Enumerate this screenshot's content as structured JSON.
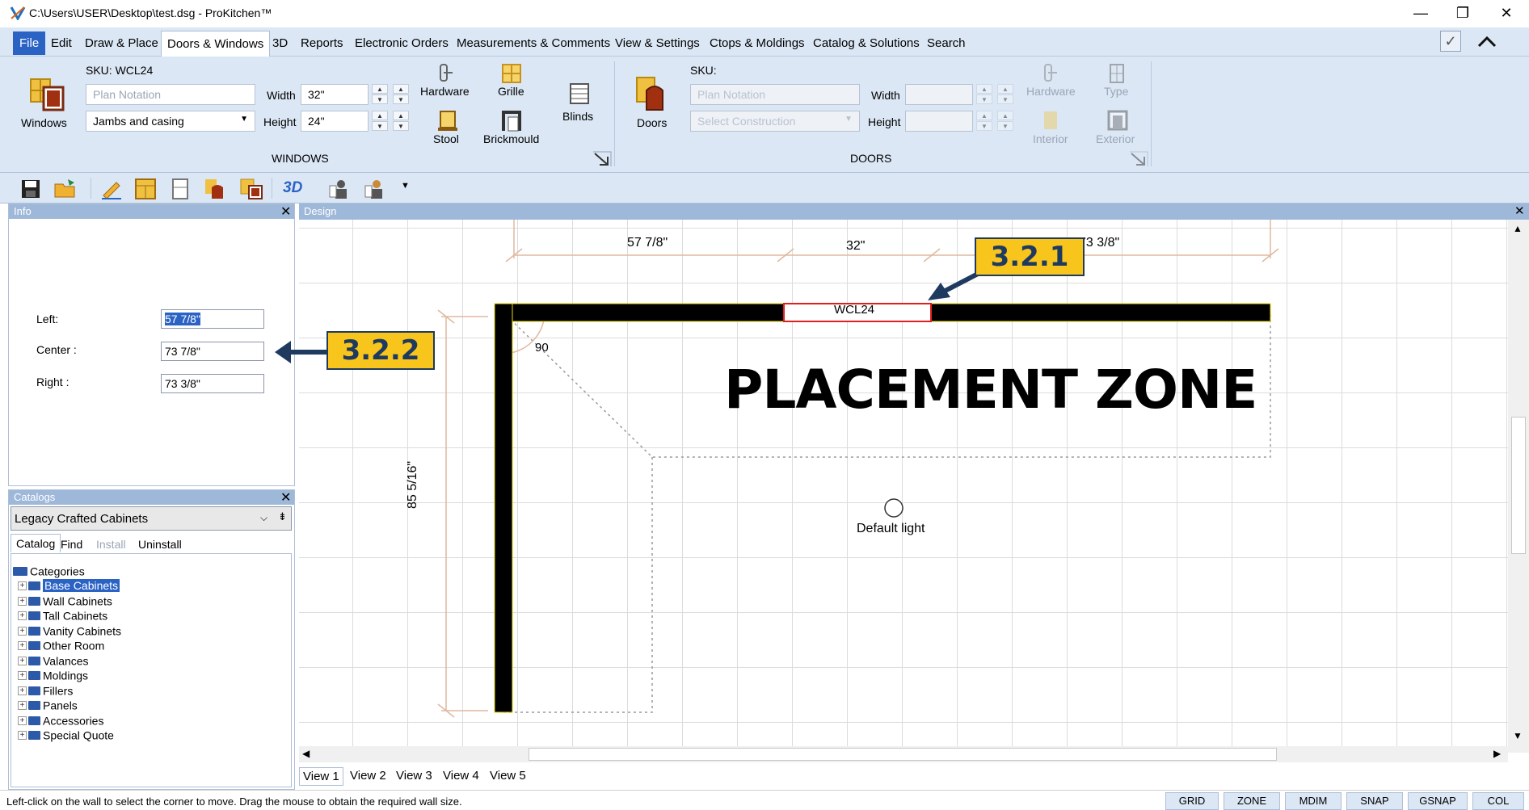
{
  "window": {
    "title": "C:\\Users\\USER\\Desktop\\test.dsg - ProKitchen™",
    "minimize": "—",
    "restore": "❐",
    "close": "✕"
  },
  "menu": {
    "items": [
      "File",
      "Edit",
      "Draw & Place",
      "Doors & Windows",
      "3D",
      "Reports",
      "Electronic Orders",
      "Measurements & Comments",
      "View & Settings",
      "Ctops & Moldings",
      "Catalog & Solutions",
      "Search"
    ],
    "active": "Doors & Windows"
  },
  "ribbon": {
    "windows": {
      "sku": "SKU: WCL24",
      "button_label": "Windows",
      "plan_notation_placeholder": "Plan Notation",
      "construction_value": "Jambs and casing",
      "width_label": "Width",
      "width_value": "32\"",
      "height_label": "Height",
      "height_value": "24\"",
      "hardware": "Hardware",
      "grille": "Grille",
      "stool": "Stool",
      "brickmould": "Brickmould",
      "blinds": "Blinds",
      "group_label": "WINDOWS"
    },
    "doors": {
      "sku": "SKU:",
      "button_label": "Doors",
      "plan_notation_placeholder": "Plan Notation",
      "construction_placeholder": "Select Construction",
      "width_label": "Width",
      "height_label": "Height",
      "hardware": "Hardware",
      "type": "Type",
      "interior": "Interior",
      "exterior": "Exterior",
      "group_label": "DOORS"
    }
  },
  "toolbar": {
    "three_d": "3D"
  },
  "info_panel": {
    "title": "Info",
    "left_label": "Left:",
    "left_value": "57 7/8\"",
    "center_label": "Center :",
    "center_value": "73 7/8\"",
    "right_label": "Right :",
    "right_value": "73 3/8\""
  },
  "catalogs_panel": {
    "title": "Catalogs",
    "selected_catalog": "Legacy Crafted Cabinets",
    "tabs": [
      "Catalog",
      "Find",
      "Install",
      "Uninstall"
    ],
    "root": "Categories",
    "categories": [
      "Base Cabinets",
      "Wall Cabinets",
      "Tall Cabinets",
      "Vanity Cabinets",
      "Other Room",
      "Valances",
      "Moldings",
      "Fillers",
      "Panels",
      "Accessories",
      "Special Quote"
    ],
    "selected_category": "Base Cabinets"
  },
  "design": {
    "title": "Design",
    "dimensions": {
      "left": "57 7/8\"",
      "center": "32\"",
      "right": "73 3/8\"",
      "vertical": "85 5/16\""
    },
    "window_label": "WCL24",
    "angle": "90",
    "zone_label": "PLACEMENT ZONE",
    "light_label": "Default light",
    "callout_1": "3.2.1",
    "callout_2": "3.2.2"
  },
  "view_tabs": [
    "View 1",
    "View 2",
    "View 3",
    "View 4",
    "View 5"
  ],
  "status": {
    "message": "Left-click on the wall to select the corner to move. Drag the mouse to obtain the required wall size.",
    "buttons": [
      "GRID",
      "ZONE",
      "MDIM",
      "SNAP",
      "GSNAP",
      "COL"
    ]
  },
  "colors": {
    "ribbon_bg": "#dbe7f5",
    "panel_header": "#9eb8d9",
    "file_menu": "#2b63c5",
    "callout_fill": "#f8c51c",
    "callout_text": "#1f3a5f",
    "dimension_line": "#e0b8a0",
    "window_outline": "#e02020"
  }
}
